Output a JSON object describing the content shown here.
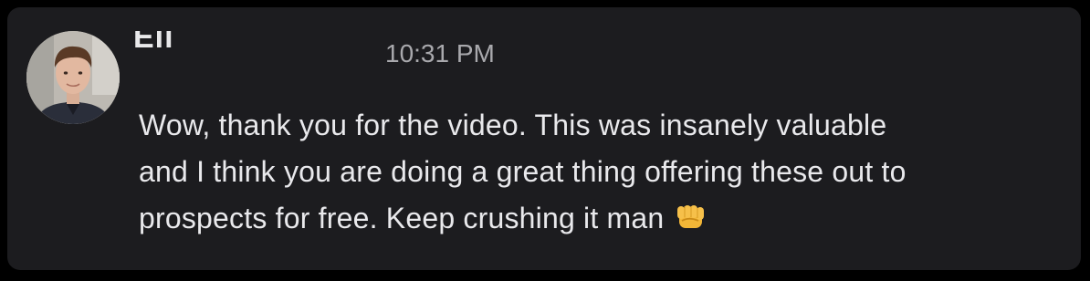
{
  "message": {
    "sender_name": "Eli",
    "timestamp": "10:31 PM",
    "lines": [
      "Wow, thank you for the video. This was insanely valuable",
      "and I think you are doing a great thing offering these out to",
      "prospects for free. Keep crushing it man"
    ],
    "emoji": "fist-bump-emoji"
  },
  "colors": {
    "background": "#000000",
    "card": "#1c1c1f",
    "text": "#e9e9ec",
    "timestamp": "#a9a9ad",
    "emoji": "#f2b637"
  }
}
